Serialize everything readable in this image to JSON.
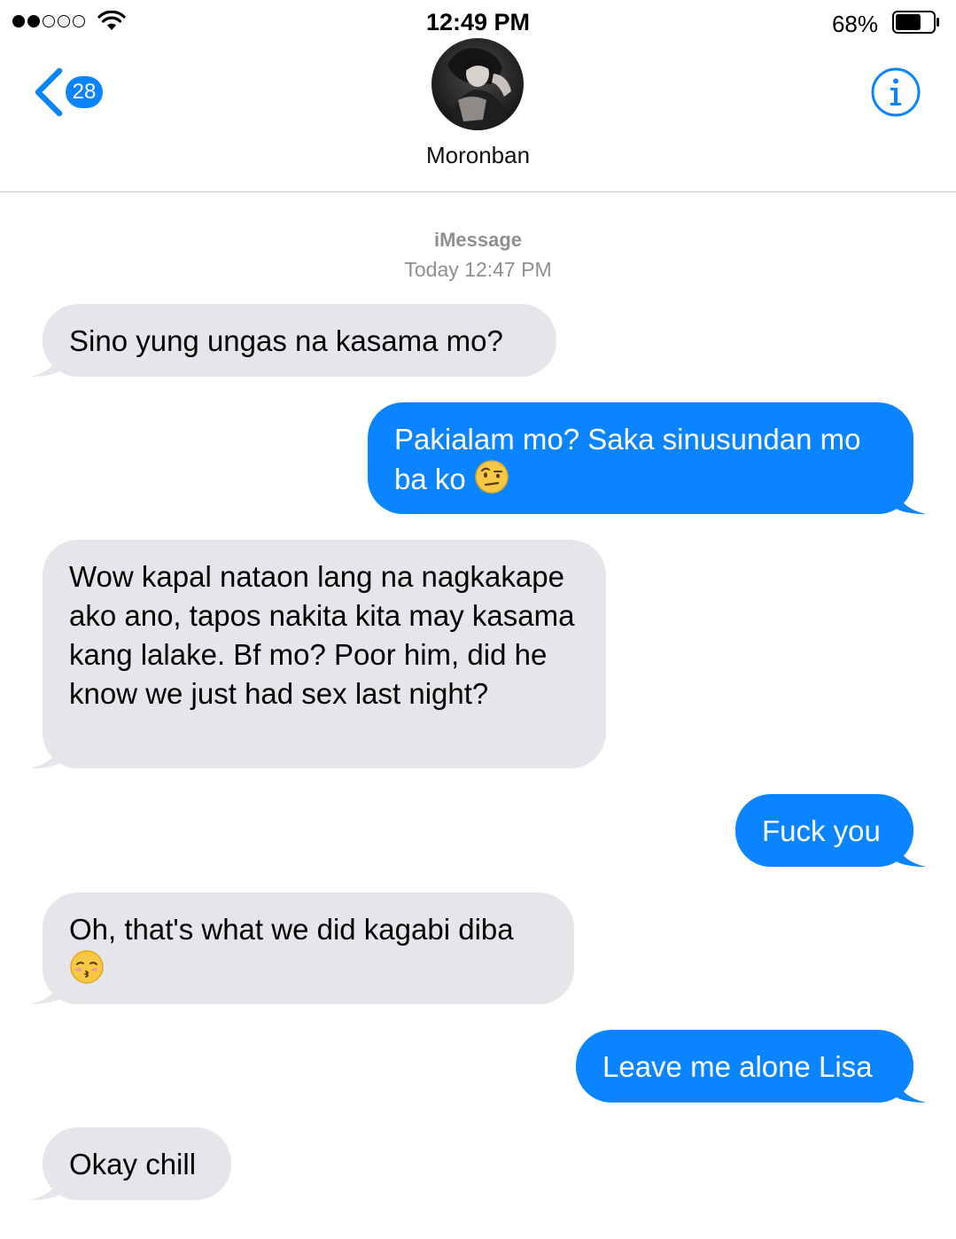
{
  "status_bar": {
    "time": "12:49 PM",
    "battery_percent": "68%",
    "signal_bars_filled": 2,
    "signal_bars_total": 5,
    "battery_level": 0.68
  },
  "header": {
    "back_badge": "28",
    "contact_name": "Moronban",
    "info_icon": "info-icon"
  },
  "thread": {
    "service": "iMessage",
    "timestamp": "Today 12:47 PM"
  },
  "messages": [
    {
      "from": "them",
      "text": "Sino yung ungas na kasama mo?"
    },
    {
      "from": "me",
      "text": "Pakialam mo? Saka sinusundan mo ba ko",
      "emoji": "face-with-raised-eyebrow"
    },
    {
      "from": "them",
      "text": "Wow kapal nataon lang na nagkakape ako ano, tapos nakita kita may kasama kang lalake. Bf mo? Poor him, did he know we just had sex last night?"
    },
    {
      "from": "me",
      "text": "Fuck you"
    },
    {
      "from": "them",
      "text": "Oh, that's what we did kagabi diba",
      "emoji": "kissing-face-with-closed-eyes"
    },
    {
      "from": "me",
      "text": "Leave me alone Lisa"
    },
    {
      "from": "them",
      "text": "Okay chill"
    }
  ],
  "colors": {
    "sent_bubble": "#0a84ff",
    "received_bubble": "#e5e5ea",
    "accent": "#0a84ff",
    "meta_text": "#8e8e93"
  }
}
